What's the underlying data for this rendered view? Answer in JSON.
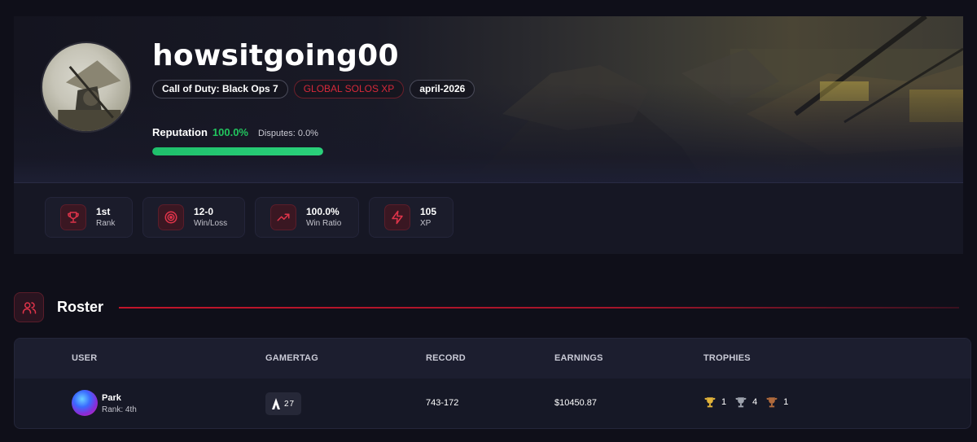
{
  "profile": {
    "username": "howsitgoing00",
    "tags": [
      {
        "label": "Call of Duty: Black Ops 7",
        "style": "default"
      },
      {
        "label": "GLOBAL SOLOS XP",
        "style": "red"
      },
      {
        "label": "april-2026",
        "style": "default"
      }
    ],
    "reputation": {
      "label": "Reputation",
      "value": "100.0%",
      "fill_fraction": 1.0,
      "disputes": "Disputes: 0.0%"
    }
  },
  "stats": [
    {
      "icon": "trophy-icon",
      "value": "1st",
      "label": "Rank"
    },
    {
      "icon": "target-icon",
      "value": "12-0",
      "label": "Win/Loss"
    },
    {
      "icon": "trending-up-icon",
      "value": "100.0%",
      "label": "Win Ratio"
    },
    {
      "icon": "lightning-icon",
      "value": "105",
      "label": "XP"
    }
  ],
  "roster": {
    "title": "Roster",
    "columns": [
      "USER",
      "GAMERTAG",
      "RECORD",
      "EARNINGS",
      "TROPHIES"
    ],
    "rows": [
      {
        "user": "Park",
        "rank": "Rank: 4th",
        "gamertag_icon": "call-of-duty-icon",
        "gamertag": "27",
        "record": "743-172",
        "earnings": "$10450.87",
        "trophies": {
          "gold": "1",
          "silver": "4",
          "bronze": "1"
        }
      }
    ]
  },
  "colors": {
    "accent_red": "#d6293a",
    "success_green": "#22c55e",
    "background": "#0f0f19",
    "card": "#161724"
  }
}
